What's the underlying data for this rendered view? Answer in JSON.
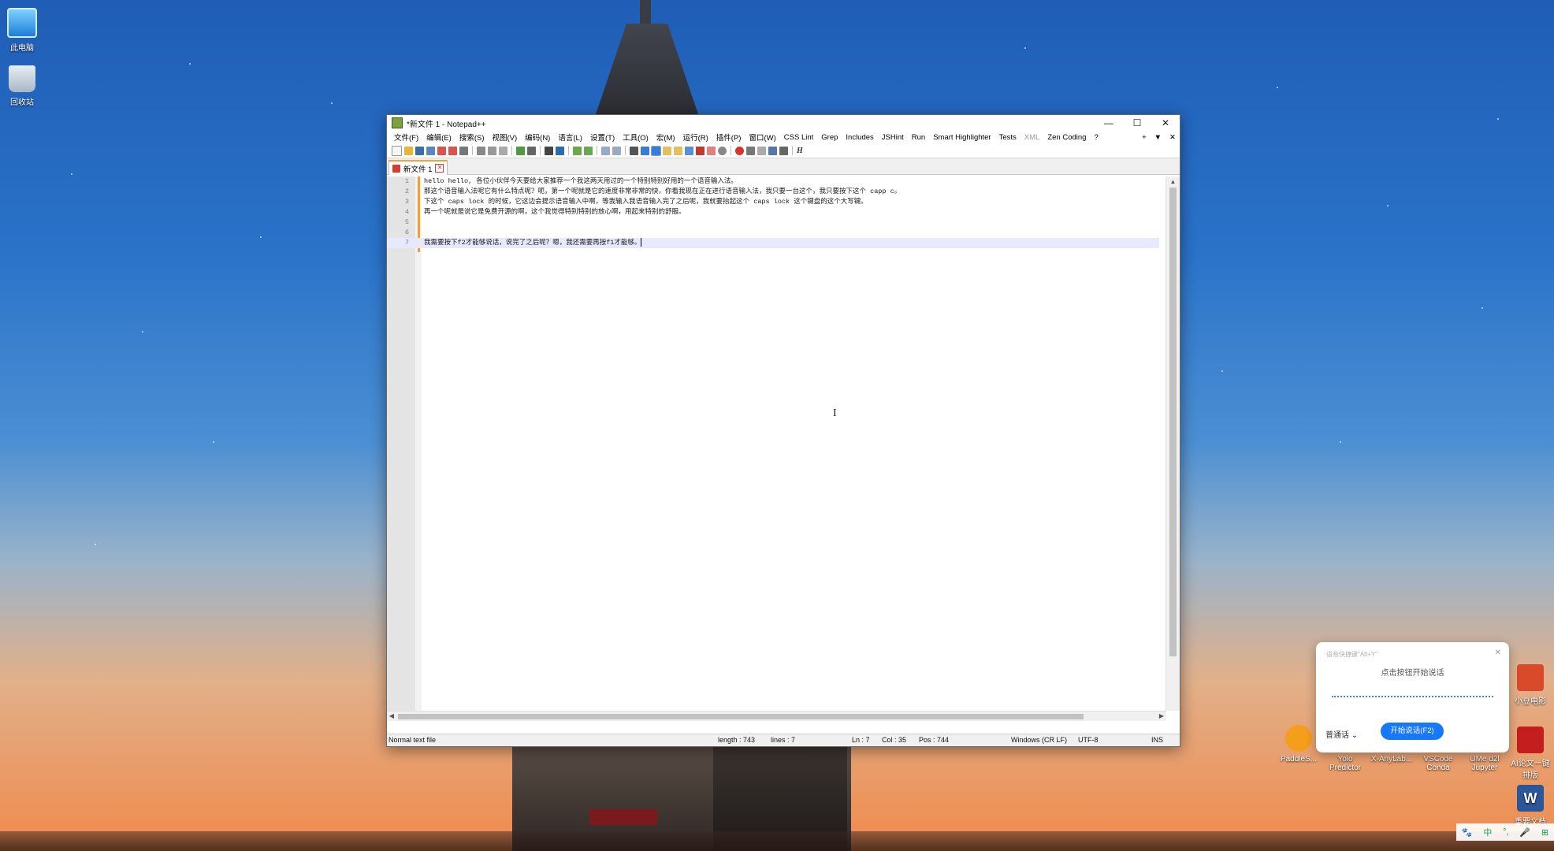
{
  "desktop": {
    "icons_left": [
      {
        "label": "此电脑",
        "icon": "computer-icon"
      },
      {
        "label": "回收站",
        "icon": "recycle-bin-icon"
      }
    ],
    "icons_right": [
      {
        "label": "小豆电影",
        "icon": "app-icon"
      },
      {
        "label": "AI论文一键排版",
        "icon": "pdf-app-icon"
      },
      {
        "label": "重要文档",
        "icon": "word-icon"
      }
    ],
    "icons_bottom": [
      {
        "label": "PaddleS...",
        "icon": "fish-app-icon"
      },
      {
        "label": "Yolo Predictor",
        "icon": "app-icon"
      },
      {
        "label": "X-AnyLab...",
        "icon": "app-icon"
      },
      {
        "label": "VSCode Conda",
        "icon": "app-icon"
      },
      {
        "label": "UMe d2l Jupyter",
        "icon": "app-icon"
      }
    ]
  },
  "window": {
    "title": "*新文件 1 - Notepad++",
    "controls": {
      "minimize": "—",
      "maximize": "☐",
      "close": "✕"
    },
    "menu": [
      "文件(F)",
      "编辑(E)",
      "搜索(S)",
      "视图(V)",
      "编码(N)",
      "语言(L)",
      "设置(T)",
      "工具(O)",
      "宏(M)",
      "运行(R)",
      "插件(P)",
      "窗口(W)",
      "CSS Lint",
      "Grep",
      "Includes",
      "JSHint",
      "Run",
      "Smart Highlighter",
      "Tests",
      "XML",
      "Zen Coding",
      "?"
    ],
    "menu_right": [
      "+",
      "▼",
      "✕"
    ],
    "tab": {
      "label": "新文件 1"
    },
    "lines": [
      {
        "n": "1",
        "text": "hello hello, 各位小伙伴今天要给大家推荐一个我这两天用过的一个特别特别好用的一个语音输入法。"
      },
      {
        "n": "2",
        "text": "那这个语音输入法呢它有什么特点呢？呃，第一个呢就是它的速度非常非常的快，你看我现在正在进行语音输入法，我只要一台这个，我只要按下这个 capp c。"
      },
      {
        "n": "3",
        "text": "下这个 caps lock 的时候，它这边会提示语音输入中啊，等我输入我语音输入完了之后呢，我就要抬起这个 caps lock 这个键盘的这个大写键。"
      },
      {
        "n": "4",
        "text": "再一个呢就是说它是免费开源的啊，这个我觉得特别特别的放心啊，用起来特别的舒服。"
      },
      {
        "n": "5",
        "text": ""
      },
      {
        "n": "6",
        "text": ""
      },
      {
        "n": "7",
        "text": "我需要按下f2才能够说话，说完了之后呢？嗯，我还需要再按f1才能够。"
      }
    ],
    "status": {
      "type": "Normal text file",
      "length": "length : 743",
      "lines": "lines : 7",
      "ln": "Ln : 7",
      "col": "Col : 35",
      "pos": "Pos : 744",
      "eol": "Windows (CR LF)",
      "encoding": "UTF-8",
      "mode": "INS"
    }
  },
  "voice_popup": {
    "hint": "语音快捷键\"Alt+Y\"",
    "prompt": "点击按钮开始说话",
    "mode": "普通话",
    "button": "开始说话(F2)",
    "close": "✕"
  },
  "tray": [
    "中",
    "°,",
    "🎤",
    "⊞"
  ]
}
